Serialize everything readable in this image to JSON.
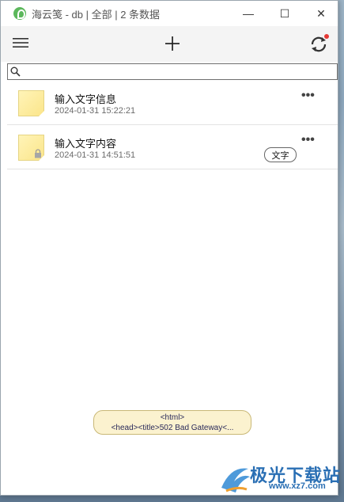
{
  "window": {
    "title": "海云笺 - db | 全部 | 2 条数据",
    "minimize": "—",
    "maximize": "☐",
    "close": "✕"
  },
  "toolbar": {
    "menu_icon": "hamburger-icon",
    "add_icon": "plus-icon",
    "sync_icon": "sync-icon",
    "sync_badge_color": "#e53935"
  },
  "search": {
    "value": "",
    "placeholder": ""
  },
  "notes": [
    {
      "title": "输入文字信息",
      "date": "2024-01-31 15:22:21",
      "more": "•••",
      "locked": false
    },
    {
      "title": "输入文字内容",
      "date": "2024-01-31 14:51:51",
      "more": "•••",
      "locked": true
    }
  ],
  "tooltip": {
    "text": "文字"
  },
  "error_bubble": {
    "line1": "<html>",
    "line2": "<head><title>502 Bad Gateway<..."
  },
  "watermark": {
    "text": "极光下载站",
    "url": "www.xz7.com"
  }
}
